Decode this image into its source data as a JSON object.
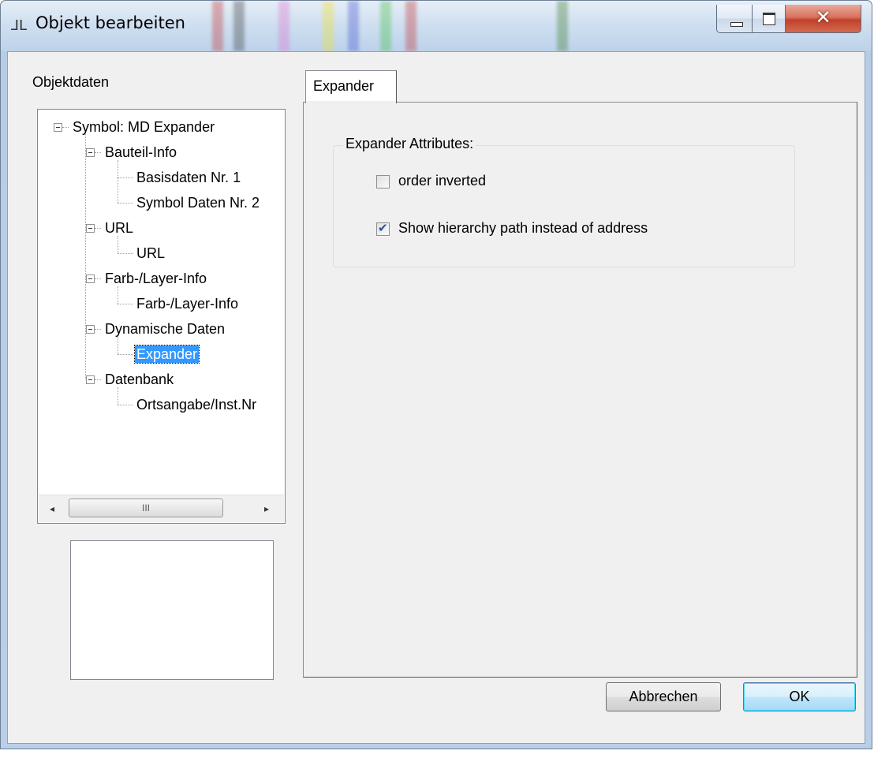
{
  "window": {
    "title": "Objekt bearbeiten"
  },
  "left_panel": {
    "label": "Objektdaten",
    "tree": [
      {
        "label": "Symbol: MD Expander",
        "level": 0,
        "selected": false
      },
      {
        "label": "Bauteil-Info",
        "level": 1,
        "selected": false
      },
      {
        "label": "Basisdaten Nr. 1",
        "level": 2,
        "selected": false
      },
      {
        "label": "Symbol Daten Nr. 2",
        "level": 2,
        "selected": false
      },
      {
        "label": "URL",
        "level": 1,
        "selected": false
      },
      {
        "label": "URL",
        "level": 2,
        "selected": false
      },
      {
        "label": "Farb-/Layer-Info",
        "level": 1,
        "selected": false
      },
      {
        "label": "Farb-/Layer-Info",
        "level": 2,
        "selected": false
      },
      {
        "label": "Dynamische Daten",
        "level": 1,
        "selected": false
      },
      {
        "label": "Expander",
        "level": 2,
        "selected": true
      },
      {
        "label": "Datenbank",
        "level": 1,
        "selected": false
      },
      {
        "label": "Ortsangabe/Inst.Nr",
        "level": 2,
        "selected": false
      }
    ],
    "scrollbar": {
      "left_arrow": "◂",
      "right_arrow": "▸",
      "thumb_grip": "III"
    }
  },
  "tabs": [
    {
      "label": "Expander",
      "active": true
    }
  ],
  "group": {
    "legend": "Expander Attributes:",
    "options": [
      {
        "label": "order inverted",
        "checked": false
      },
      {
        "label": "Show hierarchy path instead of address",
        "checked": true
      }
    ]
  },
  "buttons": {
    "cancel": "Abbrechen",
    "ok": "OK"
  },
  "colors": {
    "selection": "#3399ff",
    "close_button": "#c1412b"
  }
}
